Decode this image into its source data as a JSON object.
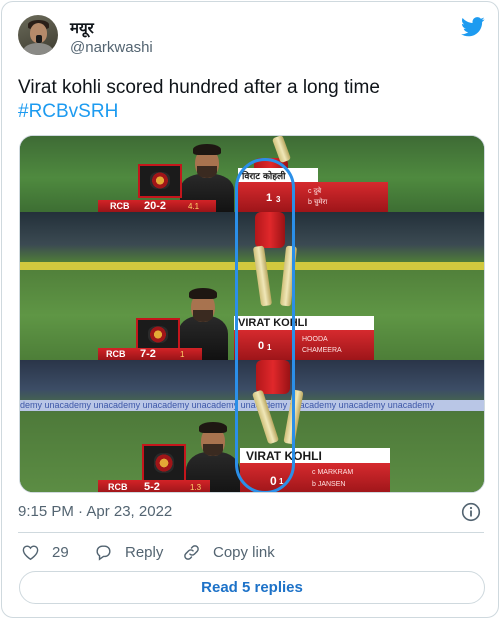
{
  "tweet": {
    "author_name": "मयूर",
    "author_handle": "@narkwashi",
    "text": "Virat kohli scored hundred after a long time",
    "hashtag": "#RCBvSRH",
    "timestamp": "9:15 PM · Apr 23, 2022",
    "likes": "29",
    "reply_label": "Reply",
    "copy_link_label": "Copy link",
    "read_replies_label": "Read 5 replies"
  },
  "media": {
    "frames": [
      {
        "team": "RCB",
        "score": "20-2",
        "overs": "4.1",
        "player_name": "विराट कोहली",
        "runs": "1",
        "balls": "3",
        "bowler_line1": "c दुबे",
        "bowler_line2": "b चुमेरा"
      },
      {
        "team": "RCB",
        "score": "7-2",
        "overs": "1",
        "player_name": "VIRAT KOHLI",
        "runs": "0",
        "balls": "1",
        "bowler_line1": "HOODA",
        "bowler_line2": "CHAMEERA"
      },
      {
        "team": "RCB",
        "score": "5-2",
        "overs": "1.3",
        "player_name": "VIRAT KOHLI",
        "runs": "0",
        "balls": "1",
        "bowler_line1": "c MARKRAM",
        "bowler_line2": "b JANSEN"
      }
    ],
    "ad_text": "demy  unacademy  unacademy  unacademy  unacademy  unacademy  unacademy  unacademy  unacademy"
  },
  "colors": {
    "accent": "#1d9bf0",
    "highlight": "#2b8fe8",
    "scorebar_red": "#c4161c"
  },
  "icons": {
    "brand": "twitter-bird-icon",
    "info": "info-icon",
    "like": "heart-icon",
    "reply": "speech-bubble-icon",
    "copy": "link-icon"
  }
}
